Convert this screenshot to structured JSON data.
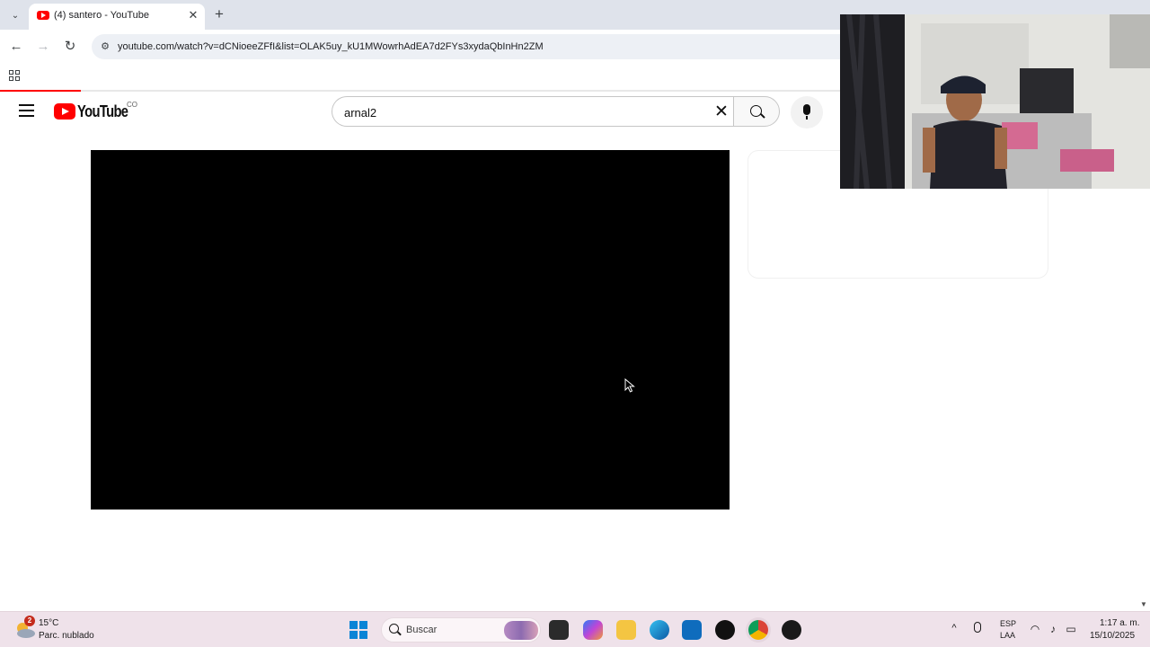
{
  "browser": {
    "tab": {
      "title": "(4) santero - YouTube",
      "close_glyph": "✕"
    },
    "new_tab_glyph": "+",
    "tab_menu_glyph": "⌄",
    "address": {
      "url": "youtube.com/watch?v=dCNioeeZFfI&list=OLAK5uy_kU1MWowrhAdEA7d2FYs3xydaQbInHn2ZM"
    },
    "nav": {
      "back_glyph": "←",
      "forward_glyph": "→",
      "reload_glyph": "↻"
    },
    "loading_progress_percent": 7,
    "colors": {
      "tabstrip": "#dfe3eb",
      "omnibox": "#edf0f5"
    }
  },
  "youtube": {
    "logo_text": "YouTube",
    "country_code": "CO",
    "search": {
      "value": "arnal2"
    },
    "clear_glyph": "✕",
    "colors": {
      "brand_red": "#ff0000"
    }
  },
  "taskbar": {
    "weather": {
      "badge": "2",
      "temperature": "15°C",
      "condition": "Parc. nublado"
    },
    "search_label": "Buscar",
    "language": {
      "line1": "ESP",
      "line2": "LAA"
    },
    "clock": {
      "time": "1:17 a. m.",
      "date": "15/10/2025"
    },
    "tray_chevron_glyph": "^",
    "apps": [
      "task-view-icon",
      "copilot-icon",
      "file-explorer-icon",
      "edge-icon",
      "outlook-icon",
      "tiktok-icon",
      "chrome-icon",
      "chatgpt-icon"
    ]
  }
}
